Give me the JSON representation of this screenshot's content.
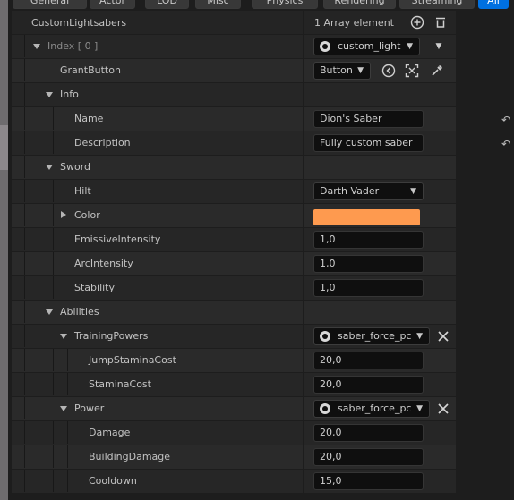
{
  "tabs": [
    "General",
    "Actor",
    "LOD",
    "Misc",
    "Physics",
    "Rendering",
    "Streaming",
    "All"
  ],
  "active_tab": "All",
  "root": {
    "label": "CustomLightsabers",
    "value": "1 Array element"
  },
  "index": {
    "label": "Index [ 0 ]",
    "asset_value": "custom_light"
  },
  "grant_button": {
    "label": "GrantButton",
    "value": "Button"
  },
  "info": {
    "label": "Info",
    "name_label": "Name",
    "name_value": "Dion's Saber",
    "description_label": "Description",
    "description_value": "Fully custom saber"
  },
  "sword": {
    "label": "Sword",
    "hilt_label": "Hilt",
    "hilt_value": "Darth Vader",
    "color_label": "Color",
    "color_value": "#fe9a4f",
    "emissive_label": "EmissiveIntensity",
    "emissive_value": "1,0",
    "arc_label": "ArcIntensity",
    "arc_value": "1,0",
    "stability_label": "Stability",
    "stability_value": "1,0"
  },
  "abilities": {
    "label": "Abilities",
    "training": {
      "label": "TrainingPowers",
      "asset_value": "saber_force_pc",
      "jump_label": "JumpStaminaCost",
      "jump_value": "20,0",
      "stamina_label": "StaminaCost",
      "stamina_value": "20,0"
    },
    "power": {
      "label": "Power",
      "asset_value": "saber_force_pc",
      "damage_label": "Damage",
      "damage_value": "20,0",
      "building_label": "BuildingDamage",
      "building_value": "20,0",
      "cooldown_label": "Cooldown",
      "cooldown_value": "15,0"
    }
  },
  "icons": {
    "add": "plus-circle-icon",
    "delete": "trash-icon",
    "reset": "reset-arrow-icon",
    "use-selected": "arrow-left-circle-icon",
    "browse": "select-actor-icon",
    "picker": "eyedropper-icon",
    "clear": "x-icon"
  },
  "colors": {
    "accent": "#0070e0",
    "swatch": "#fe9a4f"
  }
}
